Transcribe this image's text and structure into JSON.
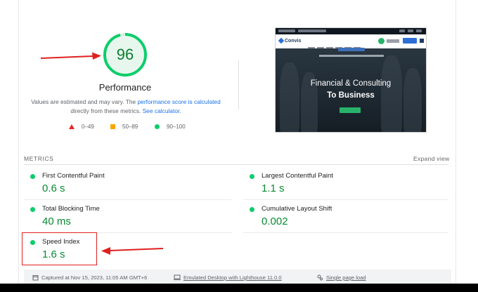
{
  "performance": {
    "score": "96",
    "title": "Performance",
    "desc_prefix": "Values are estimated and may vary. The ",
    "desc_link1": "performance score is calculated",
    "desc_mid": "directly from these metrics. ",
    "desc_link2": "See calculator.",
    "score_fraction": 0.96
  },
  "legend": [
    {
      "label": "0–49",
      "shape": "triangle",
      "color": "#e6262a"
    },
    {
      "label": "50–89",
      "shape": "square",
      "color": "#ffa400"
    },
    {
      "label": "90–100",
      "shape": "circle",
      "color": "#0cce6b"
    }
  ],
  "thumbnail": {
    "logo": "Convis",
    "headline_line1": "Financial & Consulting",
    "headline_line2": "To Business"
  },
  "metrics": {
    "section_label": "METRICS",
    "expand_label": "Expand view",
    "items": [
      {
        "name": "First Contentful Paint",
        "value": "0.6 s"
      },
      {
        "name": "Largest Contentful Paint",
        "value": "1.1 s"
      },
      {
        "name": "Total Blocking Time",
        "value": "40 ms"
      },
      {
        "name": "Cumulative Layout Shift",
        "value": "0.002"
      },
      {
        "name": "Speed Index",
        "value": "1.6 s"
      }
    ]
  },
  "footer": {
    "captured": "Captured at Nov 15, 2023, 11:05 AM GMT+6",
    "emulated": "Emulated Desktop with Lighthouse 11.0.0",
    "single_page": "Single page load"
  },
  "colors": {
    "pass_green": "#0cce6b",
    "score_text": "#0a7c2e",
    "annotation_red": "#e02020",
    "link_blue": "#1a73e8"
  }
}
